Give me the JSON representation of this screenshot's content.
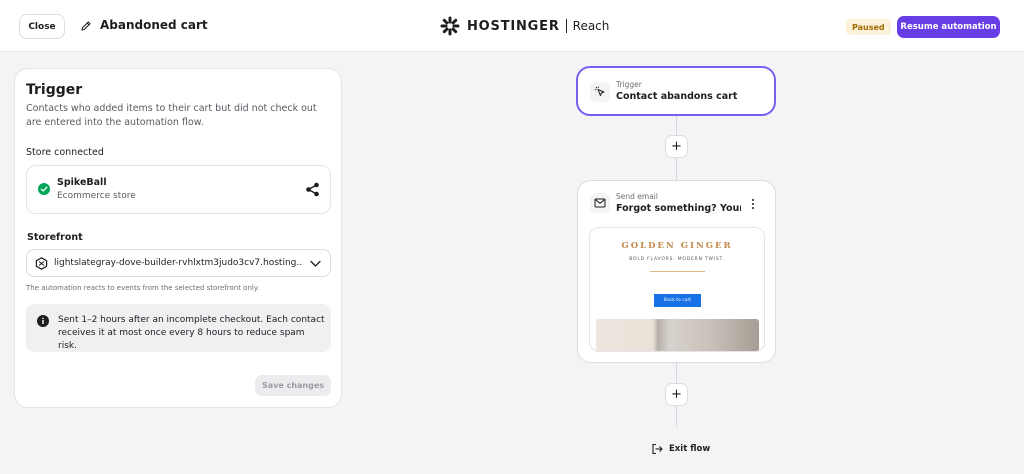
{
  "header": {
    "close_label": "Close",
    "title": "Abandoned cart",
    "logo_text": "HOSTINGER",
    "logo_sub": "Reach",
    "status": "Paused",
    "resume_label": "Resume automation"
  },
  "trigger_panel": {
    "title": "Trigger",
    "description": "Contacts who added items to their cart but did not check out are entered into the automation flow.",
    "store_label": "Store connected",
    "store_name": "SpikeBall",
    "store_type": "Ecommerce store",
    "storefront_label": "Storefront",
    "storefront_value": "lightslategray-dove-builder-rvhlxtm3judo3cv7.hosting...",
    "hint": "The automation reacts to events from the selected storefront only.",
    "info": "Sent 1–2 hours after an incomplete checkout. Each contact receives it at most once every 8 hours to reduce spam risk.",
    "save_label": "Save changes"
  },
  "flow": {
    "trigger_caption": "Trigger",
    "trigger_title": "Contact abandons cart",
    "add_label": "+",
    "email_caption": "Send email",
    "email_title": "Forgot something? Your ...",
    "preview": {
      "brand": "GOLDEN GINGER",
      "tagline": "BOLD FLAVORS. MODERN TWIST.",
      "cta": "Back to cart"
    },
    "exit_label": "Exit flow"
  },
  "colors": {
    "accent": "#673de6",
    "paused_bg": "#fdf1d9",
    "paused_text": "#a06a00",
    "success": "#00a65a"
  }
}
